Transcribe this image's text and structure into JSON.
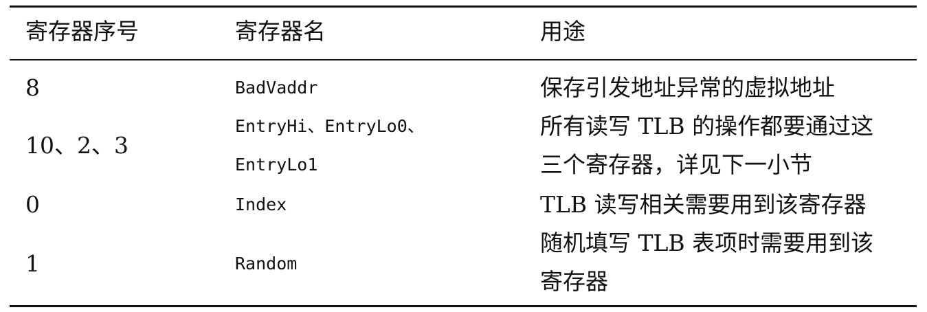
{
  "table": {
    "headers": [
      "寄存器序号",
      "寄存器名",
      "用途"
    ],
    "rows": [
      {
        "number": "8",
        "name": [
          "BadVaddr"
        ],
        "purpose": [
          "保存引发地址异常的虚拟地址"
        ]
      },
      {
        "number": "10、2、3",
        "name": [
          "EntryHi、EntryLo0、",
          "EntryLo1"
        ],
        "purpose": [
          "所有读写 TLB 的操作都要通过这",
          "三个寄存器，详见下一小节"
        ]
      },
      {
        "number": "0",
        "name": [
          "Index"
        ],
        "purpose": [
          "TLB 读写相关需要用到该寄存器"
        ]
      },
      {
        "number": "1",
        "name": [
          "Random"
        ],
        "purpose": [
          "随机填写 TLB 表项时需要用到该",
          "寄存器"
        ]
      }
    ]
  }
}
